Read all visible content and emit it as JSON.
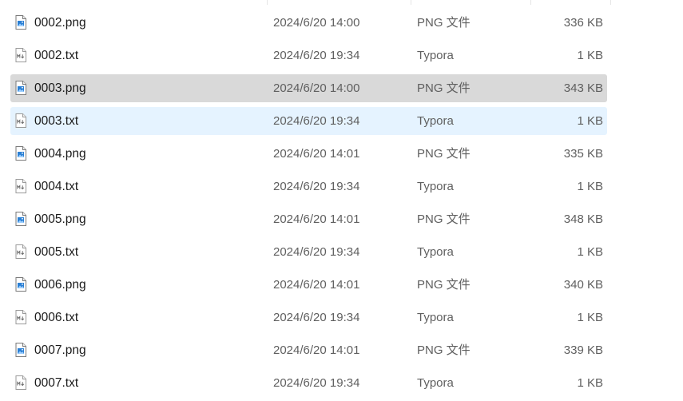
{
  "files": [
    {
      "name": "0002.png",
      "date": "2024/6/20 14:00",
      "type": "PNG 文件",
      "size": "336 KB",
      "icon": "png-file-icon",
      "state": ""
    },
    {
      "name": "0002.txt",
      "date": "2024/6/20 19:34",
      "type": "Typora",
      "size": "1 KB",
      "icon": "markdown-file-icon",
      "state": ""
    },
    {
      "name": "0003.png",
      "date": "2024/6/20 14:00",
      "type": "PNG 文件",
      "size": "343 KB",
      "icon": "png-file-icon",
      "state": "selected"
    },
    {
      "name": "0003.txt",
      "date": "2024/6/20 19:34",
      "type": "Typora",
      "size": "1 KB",
      "icon": "markdown-file-icon",
      "state": "hovered"
    },
    {
      "name": "0004.png",
      "date": "2024/6/20 14:01",
      "type": "PNG 文件",
      "size": "335 KB",
      "icon": "png-file-icon",
      "state": ""
    },
    {
      "name": "0004.txt",
      "date": "2024/6/20 19:34",
      "type": "Typora",
      "size": "1 KB",
      "icon": "markdown-file-icon",
      "state": ""
    },
    {
      "name": "0005.png",
      "date": "2024/6/20 14:01",
      "type": "PNG 文件",
      "size": "348 KB",
      "icon": "png-file-icon",
      "state": ""
    },
    {
      "name": "0005.txt",
      "date": "2024/6/20 19:34",
      "type": "Typora",
      "size": "1 KB",
      "icon": "markdown-file-icon",
      "state": ""
    },
    {
      "name": "0006.png",
      "date": "2024/6/20 14:01",
      "type": "PNG 文件",
      "size": "340 KB",
      "icon": "png-file-icon",
      "state": ""
    },
    {
      "name": "0006.txt",
      "date": "2024/6/20 19:34",
      "type": "Typora",
      "size": "1 KB",
      "icon": "markdown-file-icon",
      "state": ""
    },
    {
      "name": "0007.png",
      "date": "2024/6/20 14:01",
      "type": "PNG 文件",
      "size": "339 KB",
      "icon": "png-file-icon",
      "state": ""
    },
    {
      "name": "0007.txt",
      "date": "2024/6/20 19:34",
      "type": "Typora",
      "size": "1 KB",
      "icon": "markdown-file-icon",
      "state": ""
    }
  ],
  "colors": {
    "selected_row": "#d9d9d9",
    "hover_row": "#e5f3ff",
    "png_icon_accent": "#2a7fd4",
    "secondary_text": "#5f5f5f"
  }
}
